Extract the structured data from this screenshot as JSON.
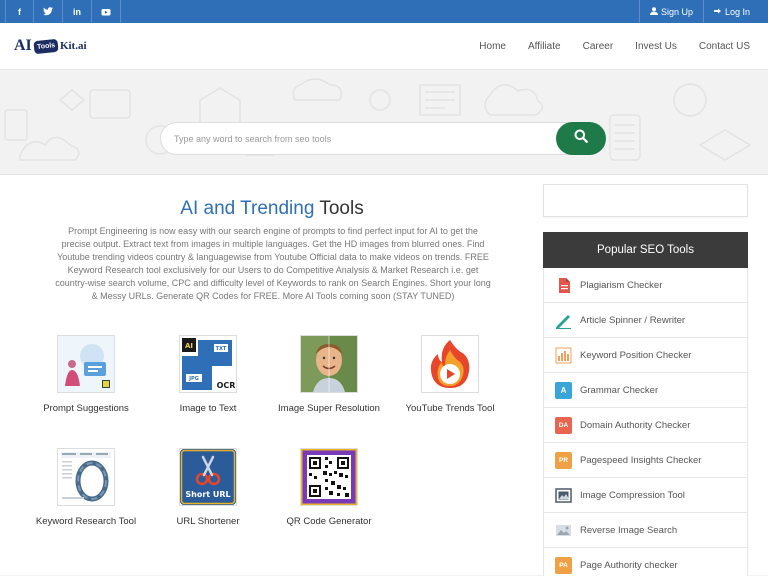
{
  "topbar": {
    "social": [
      "f",
      "t",
      "in",
      "yt"
    ],
    "signup": "Sign Up",
    "login": "Log In"
  },
  "logo": {
    "part1": "AI",
    "part2": "Tools",
    "part3": "Kit.ai"
  },
  "nav": {
    "items": [
      "Home",
      "Affiliate",
      "Career",
      "Invest Us",
      "Contact US"
    ]
  },
  "search": {
    "placeholder": "Type any word to search from seo tools"
  },
  "main": {
    "title_highlight": "AI and Trending",
    "title_rest": "Tools",
    "description": "Prompt Engineering is now easy with our search engine of prompts to find perfect input for AI to get the precise output. Extract text from images in multiple languages. Get the HD images from blurred ones. Find Youtube trending videos country & languagewise from Youtube Official data to make videos on trends. FREE Keyword Research tool exclusively for our Users to do Competitive Analysis & Market Research i.e. get country-wise search volume, CPC and difficulty level of Keywords to rank on Search Engines. Short your long & Messy URLs. Generate QR Codes for FREE. More AI Tools coming soon (STAY TUNED)",
    "tools": [
      {
        "label": "Prompt Suggestions"
      },
      {
        "label": "Image to Text",
        "thumb_text": [
          "AI",
          "TXT",
          "JPG",
          "OCR"
        ]
      },
      {
        "label": "Image Super Resolution"
      },
      {
        "label": "YouTube Trends Tool"
      },
      {
        "label": "Keyword Research Tool"
      },
      {
        "label": "URL Shortener",
        "thumb_text": [
          "Short URL"
        ]
      },
      {
        "label": "QR Code Generator"
      }
    ]
  },
  "sidebar": {
    "heading": "Popular SEO Tools",
    "items": [
      {
        "label": "Plagiarism Checker",
        "icon": "plagiarism-icon",
        "color": "#e2574c"
      },
      {
        "label": "Article Spinner / Rewriter",
        "icon": "pen-icon",
        "color": "#2aa198"
      },
      {
        "label": "Keyword Position Checker",
        "icon": "bar-chart-icon",
        "color": "#f0a05a"
      },
      {
        "label": "Grammar Checker",
        "icon": "grammar-icon",
        "color": "#3aa6d8",
        "badge": "A"
      },
      {
        "label": "Domain Authority Checker",
        "icon": "da-icon",
        "color": "#e8664f",
        "badge": "DA"
      },
      {
        "label": "Pagespeed Insights Checker",
        "icon": "pr-icon",
        "color": "#f0a045",
        "badge": "PR"
      },
      {
        "label": "Image Compression Tool",
        "icon": "image-compress-icon",
        "color": "#4a5a6a"
      },
      {
        "label": "Reverse Image Search",
        "icon": "image-icon",
        "color": "#aab4bd"
      },
      {
        "label": "Page Authority checker",
        "icon": "pa-icon",
        "color": "#f0a045",
        "badge": "PA"
      }
    ]
  }
}
